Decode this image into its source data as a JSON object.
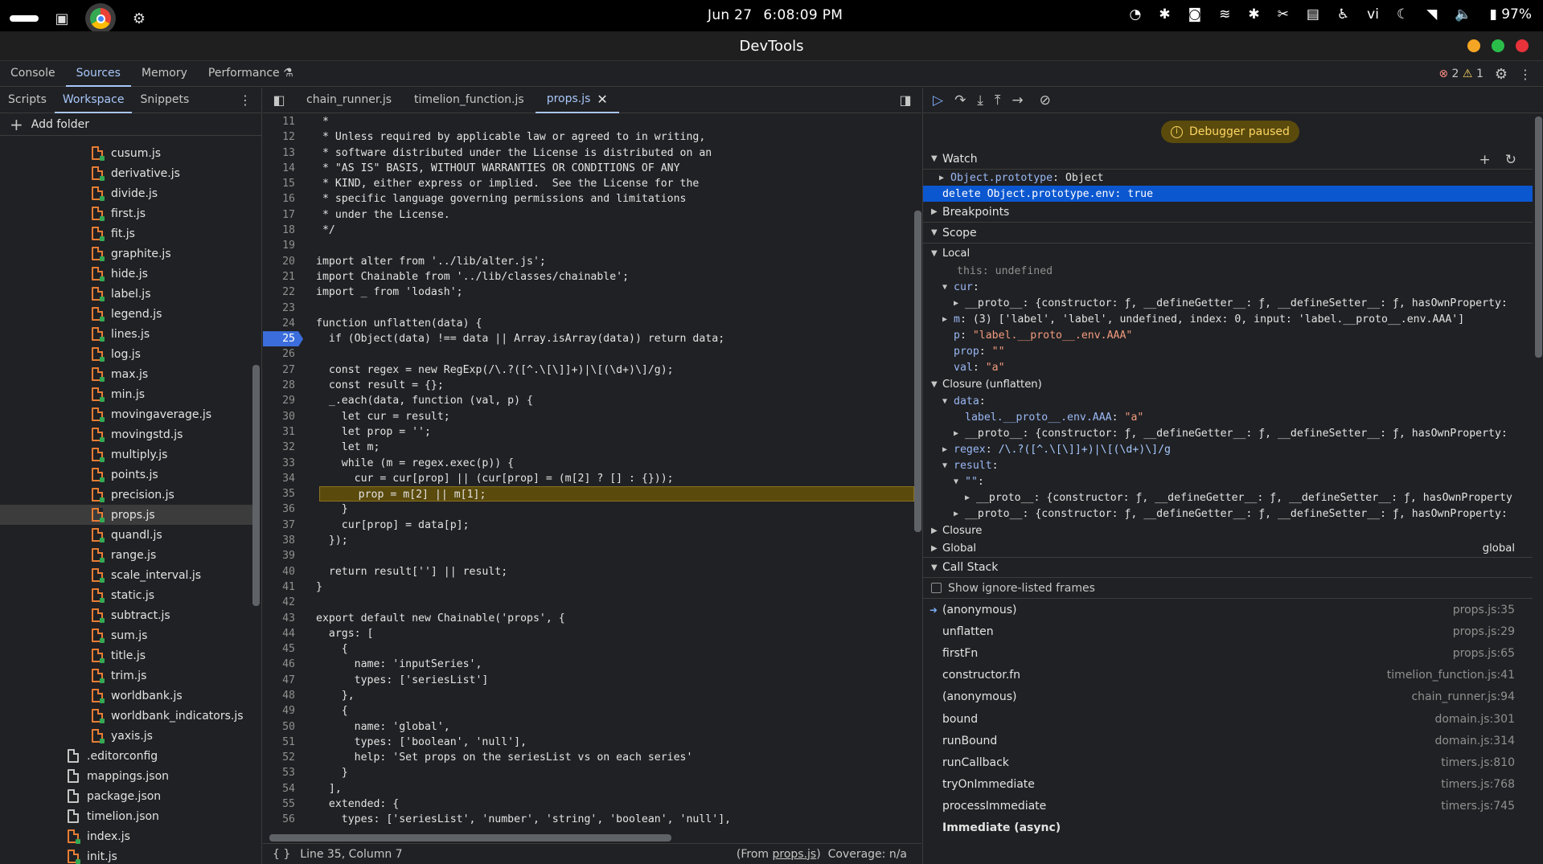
{
  "system": {
    "date": "Jun 27",
    "time": "6:08:09 PM",
    "lang": "vi",
    "battery": "97%"
  },
  "window": {
    "title": "DevTools"
  },
  "top_tabs": [
    {
      "label": "Console"
    },
    {
      "label": "Sources"
    },
    {
      "label": "Memory"
    },
    {
      "label": "Performance"
    }
  ],
  "top_right": {
    "errors": "2",
    "warnings": "1"
  },
  "navigator": {
    "tabs": [
      {
        "label": "Scripts"
      },
      {
        "label": "Workspace"
      },
      {
        "label": "Snippets"
      }
    ],
    "add_folder": "Add folder",
    "files": [
      {
        "name": "cusum.js"
      },
      {
        "name": "derivative.js"
      },
      {
        "name": "divide.js"
      },
      {
        "name": "first.js"
      },
      {
        "name": "fit.js"
      },
      {
        "name": "graphite.js"
      },
      {
        "name": "hide.js"
      },
      {
        "name": "label.js"
      },
      {
        "name": "legend.js"
      },
      {
        "name": "lines.js"
      },
      {
        "name": "log.js"
      },
      {
        "name": "max.js"
      },
      {
        "name": "min.js"
      },
      {
        "name": "movingaverage.js"
      },
      {
        "name": "movingstd.js"
      },
      {
        "name": "multiply.js"
      },
      {
        "name": "points.js"
      },
      {
        "name": "precision.js"
      },
      {
        "name": "props.js"
      },
      {
        "name": "quandl.js"
      },
      {
        "name": "range.js"
      },
      {
        "name": "scale_interval.js"
      },
      {
        "name": "static.js"
      },
      {
        "name": "subtract.js"
      },
      {
        "name": "sum.js"
      },
      {
        "name": "title.js"
      },
      {
        "name": "trim.js"
      },
      {
        "name": "worldbank.js"
      },
      {
        "name": "worldbank_indicators.js"
      },
      {
        "name": "yaxis.js"
      }
    ],
    "root_files": [
      {
        "name": ".editorconfig"
      },
      {
        "name": "mappings.json"
      },
      {
        "name": "package.json"
      },
      {
        "name": "timelion.json"
      },
      {
        "name": "index.js"
      },
      {
        "name": "init.js"
      }
    ]
  },
  "editor": {
    "tabs": [
      {
        "label": "chain_runner.js"
      },
      {
        "label": "timelion_function.js"
      },
      {
        "label": "props.js"
      }
    ],
    "lines": [
      {
        "n": "11",
        "t": " *"
      },
      {
        "n": "12",
        "t": " * Unless required by applicable law or agreed to in writing,"
      },
      {
        "n": "13",
        "t": " * software distributed under the License is distributed on an"
      },
      {
        "n": "14",
        "t": " * \"AS IS\" BASIS, WITHOUT WARRANTIES OR CONDITIONS OF ANY"
      },
      {
        "n": "15",
        "t": " * KIND, either express or implied.  See the License for the"
      },
      {
        "n": "16",
        "t": " * specific language governing permissions and limitations"
      },
      {
        "n": "17",
        "t": " * under the License."
      },
      {
        "n": "18",
        "t": " */"
      },
      {
        "n": "19",
        "t": ""
      },
      {
        "n": "20",
        "t": "import alter from '../lib/alter.js';"
      },
      {
        "n": "21",
        "t": "import Chainable from '../lib/classes/chainable';"
      },
      {
        "n": "22",
        "t": "import _ from 'lodash';"
      },
      {
        "n": "23",
        "t": ""
      },
      {
        "n": "24",
        "t": "function unflatten(data) {"
      },
      {
        "n": "25",
        "t": "  if (Object(data) !== data || Array.isArray(data)) return data;"
      },
      {
        "n": "26",
        "t": ""
      },
      {
        "n": "27",
        "t": "  const regex = new RegExp(/\\.?([^.\\[\\]]+)|\\[(\\d+)\\]/g);"
      },
      {
        "n": "28",
        "t": "  const result = {};"
      },
      {
        "n": "29",
        "t": "  _.each(data, function (val, p) {"
      },
      {
        "n": "30",
        "t": "    let cur = result;"
      },
      {
        "n": "31",
        "t": "    let prop = '';"
      },
      {
        "n": "32",
        "t": "    let m;"
      },
      {
        "n": "33",
        "t": "    while (m = regex.exec(p)) {"
      },
      {
        "n": "34",
        "t": "      cur = cur[prop] || (cur[prop] = (m[2] ? [] : {}));"
      },
      {
        "n": "35",
        "t": "      prop = m[2] || m[1];"
      },
      {
        "n": "36",
        "t": "    }"
      },
      {
        "n": "37",
        "t": "    cur[prop] = data[p];"
      },
      {
        "n": "38",
        "t": "  });"
      },
      {
        "n": "39",
        "t": ""
      },
      {
        "n": "40",
        "t": "  return result[''] || result;"
      },
      {
        "n": "41",
        "t": "}"
      },
      {
        "n": "42",
        "t": ""
      },
      {
        "n": "43",
        "t": "export default new Chainable('props', {"
      },
      {
        "n": "44",
        "t": "  args: ["
      },
      {
        "n": "45",
        "t": "    {"
      },
      {
        "n": "46",
        "t": "      name: 'inputSeries',"
      },
      {
        "n": "47",
        "t": "      types: ['seriesList']"
      },
      {
        "n": "48",
        "t": "    },"
      },
      {
        "n": "49",
        "t": "    {"
      },
      {
        "n": "50",
        "t": "      name: 'global',"
      },
      {
        "n": "51",
        "t": "      types: ['boolean', 'null'],"
      },
      {
        "n": "52",
        "t": "      help: 'Set props on the seriesList vs on each series'"
      },
      {
        "n": "53",
        "t": "    }"
      },
      {
        "n": "54",
        "t": "  ],"
      },
      {
        "n": "55",
        "t": "  extended: {"
      },
      {
        "n": "56",
        "t": "    types: ['seriesList', 'number', 'string', 'boolean', 'null'],"
      }
    ],
    "status": {
      "position": "Line 35, Column 7",
      "from_prefix": "(From ",
      "from_file": "props.js",
      "from_suffix": ")",
      "coverage": "Coverage: n/a"
    }
  },
  "debugger": {
    "paused": "Debugger paused",
    "watch_title": "Watch",
    "watch": [
      {
        "key": "Object.prototype",
        "value": "Object"
      },
      {
        "key": "delete Object.prototype.env",
        "value": "true"
      }
    ],
    "breakpoints_title": "Breakpoints",
    "scope_title": "Scope",
    "local_title": "Local",
    "local": {
      "this_key": "this",
      "this_val": "undefined",
      "cur_key": "cur",
      "cur_proto": "__proto__: {constructor: ƒ, __defineGetter__: ƒ, __defineSetter__: ƒ, hasOwnProperty: ",
      "m_key": "m",
      "m_val": "(3) ['label', 'label', undefined, index: 0, input: 'label.__proto__.env.AAA']",
      "p_key": "p",
      "p_val": "\"label.__proto__.env.AAA\"",
      "prop_key": "prop",
      "prop_val": "\"\"",
      "val_key": "val",
      "val_val": "\"a\""
    },
    "closure_title": "Closure (unflatten)",
    "closure": {
      "data_key": "data",
      "data_entry_key": "label.__proto__.env.AAA",
      "data_entry_val": "\"a\"",
      "data_proto": "__proto__: {constructor: ƒ, __defineGetter__: ƒ, __defineSetter__: ƒ, hasOwnProperty: ",
      "regex_key": "regex",
      "regex_val": "/\\.?([^.\\[\\]]+)|\\[(\\d+)\\]/g",
      "result_key": "result",
      "empty_key": "\"\"",
      "inner_proto": "__proto__: {constructor: ƒ, __defineGetter__: ƒ, __defineSetter__: ƒ, hasOwnProperty",
      "result_proto": "__proto__: {constructor: ƒ, __defineGetter__: ƒ, __defineSetter__: ƒ, hasOwnProperty: "
    },
    "closure2_title": "Closure",
    "global_title": "Global",
    "global_val": "global",
    "callstack_title": "Call Stack",
    "show_ignored": "Show ignore-listed frames",
    "frames": [
      {
        "name": "(anonymous)",
        "loc": "props.js:35"
      },
      {
        "name": "unflatten",
        "loc": "props.js:29"
      },
      {
        "name": "firstFn",
        "loc": "props.js:65"
      },
      {
        "name": "constructor.fn",
        "loc": "timelion_function.js:41"
      },
      {
        "name": "(anonymous)",
        "loc": "chain_runner.js:94"
      },
      {
        "name": "bound",
        "loc": "domain.js:301"
      },
      {
        "name": "runBound",
        "loc": "domain.js:314"
      },
      {
        "name": "runCallback",
        "loc": "timers.js:810"
      },
      {
        "name": "tryOnImmediate",
        "loc": "timers.js:768"
      },
      {
        "name": "processImmediate",
        "loc": "timers.js:745"
      }
    ],
    "async_label": "Immediate (async)"
  },
  "colors": {
    "accent": "#a8c7fa",
    "paused_bg": "#5a4a0c",
    "error": "#f28b82",
    "warning": "#fdd663"
  }
}
